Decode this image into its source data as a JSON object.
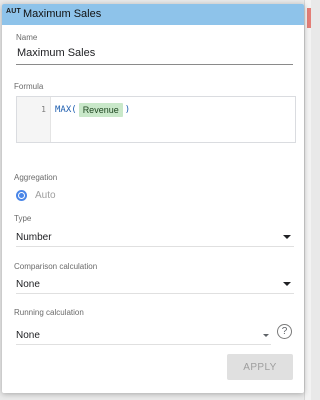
{
  "header": {
    "type_badge": "AUT",
    "title": "Maximum Sales"
  },
  "name_field": {
    "label": "Name",
    "value": "Maximum Sales"
  },
  "formula": {
    "label": "Formula",
    "line_number": "1",
    "function_open": "MAX(",
    "field": "Revenue",
    "function_close": ")"
  },
  "aggregation": {
    "label": "Aggregation",
    "option": "Auto",
    "selected": true
  },
  "type": {
    "label": "Type",
    "value": "Number"
  },
  "comparison": {
    "label": "Comparison calculation",
    "value": "None"
  },
  "running": {
    "label": "Running calculation",
    "value": "None"
  },
  "help_icon_text": "?",
  "apply_label": "APPLY",
  "colors": {
    "header": "#8ec3ea",
    "accent": "#4a86e8",
    "field_chip": "#c9e8c9"
  }
}
